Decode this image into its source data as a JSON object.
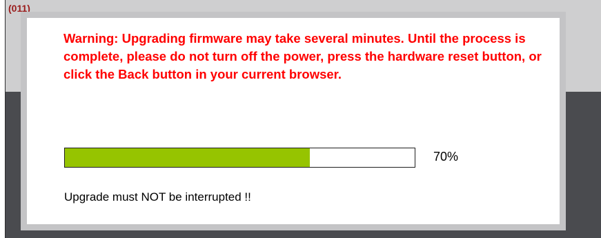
{
  "background": {
    "code_text": "(011)"
  },
  "dialog": {
    "warning": "Warning: Upgrading firmware may take several minutes. Until the process is complete, please do not turn off the power, press the hardware reset button, or click the Back button in your current browser.",
    "progress_value": 70,
    "progress_label": "70%",
    "notice": "Upgrade must NOT be interrupted !!"
  },
  "colors": {
    "warning_text": "#ff0000",
    "progress_fill": "#96c400",
    "modal_border": "#c4c4c6",
    "backdrop": "#4a4b4f"
  }
}
